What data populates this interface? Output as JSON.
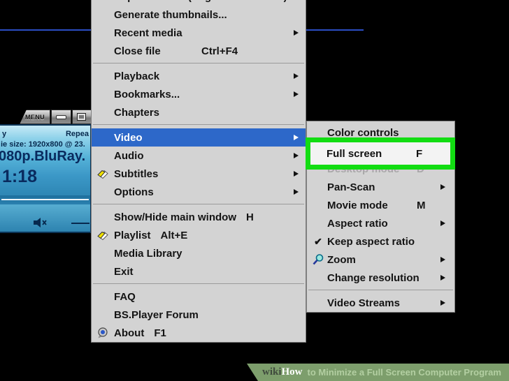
{
  "colors": {
    "highlight_blue": "#2d68c9",
    "selection_green": "#12dd12",
    "menu_bg": "#d3d3d3",
    "banner_green": "#7d9e6c",
    "desktop_line_blue": "#2b4dc4",
    "player_text_navy": "#092a5e"
  },
  "player": {
    "titlebar": {
      "menu_label": "MENU"
    },
    "fragment_left": "y",
    "repeat_label": "Repea",
    "movie_size": "ie size: 1920x800 @ 23.",
    "filename": "080p.BluRay.",
    "elapsed_time": "1:18"
  },
  "main_menu": {
    "items": [
      {
        "label": "Capture frame (original frame size)",
        "clipped": true
      },
      {
        "label": "Generate thumbnails..."
      },
      {
        "label": "Recent media",
        "submenu": true
      },
      {
        "label": "Close file",
        "shortcut": "Ctrl+F4"
      },
      {
        "type": "separator"
      },
      {
        "label": "Playback",
        "submenu": true
      },
      {
        "label": "Bookmarks...",
        "submenu": true
      },
      {
        "label": "Chapters"
      },
      {
        "type": "separator"
      },
      {
        "label": "Video",
        "submenu": true,
        "highlighted": true
      },
      {
        "label": "Audio",
        "submenu": true
      },
      {
        "label": "Subtitles",
        "submenu": true,
        "icon": "subtitles-icon"
      },
      {
        "label": "Options",
        "submenu": true
      },
      {
        "type": "separator"
      },
      {
        "label": "Show/Hide main window",
        "inline_shortcut": "H"
      },
      {
        "label": "Playlist",
        "inline_shortcut": "Alt+E",
        "icon": "playlist-icon"
      },
      {
        "label": "Media Library"
      },
      {
        "label": "Exit"
      },
      {
        "type": "separator"
      },
      {
        "label": "FAQ"
      },
      {
        "label": "BS.Player Forum"
      },
      {
        "label": "About",
        "inline_shortcut": "F1",
        "icon": "bsplayer-logo-icon"
      }
    ]
  },
  "video_submenu": {
    "items": [
      {
        "label": "Color controls"
      },
      {
        "label": "Full screen",
        "shortcut": "F",
        "highlighted_box": true
      },
      {
        "label": "Desktop mode",
        "shortcut": "D",
        "disabled": true
      },
      {
        "label": "Pan-Scan",
        "submenu": true
      },
      {
        "label": "Movie mode",
        "shortcut": "M"
      },
      {
        "label": "Aspect ratio",
        "submenu": true
      },
      {
        "label": "Keep aspect ratio",
        "icon": "checkmark-icon",
        "checked": true
      },
      {
        "label": "Zoom",
        "submenu": true,
        "icon": "magnifier-icon"
      },
      {
        "label": "Change resolution",
        "submenu": true
      },
      {
        "type": "separator"
      },
      {
        "label": "Video Streams",
        "submenu": true
      }
    ]
  },
  "watermark": {
    "wiki": "wiki",
    "how": "How",
    "tagline": "to Minimize a Full Screen Computer Program"
  }
}
